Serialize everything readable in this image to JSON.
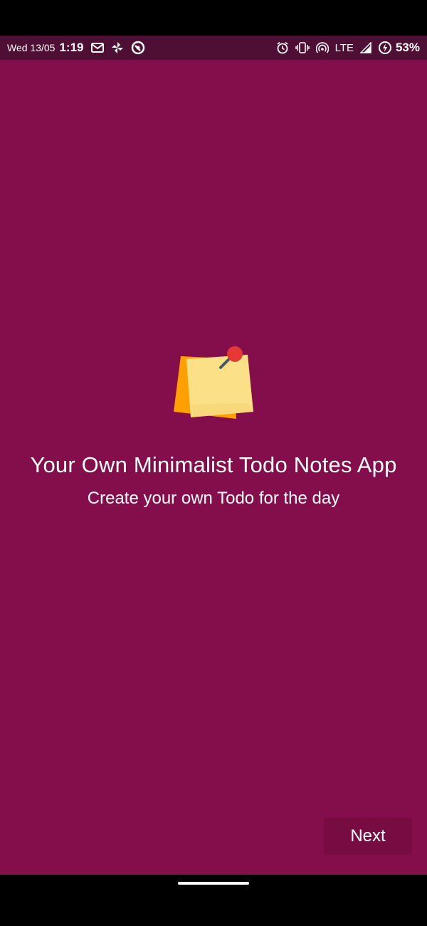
{
  "status_bar": {
    "date": "Wed 13/05",
    "time": "1:19",
    "network": "LTE",
    "battery": "53%",
    "icons_left": [
      "gmail-icon",
      "pinwheel-icon",
      "vpn-icon"
    ],
    "icons_right": [
      "alarm-icon",
      "vibrate-icon",
      "hotspot-icon",
      "signal-icon",
      "battery-saver-icon"
    ]
  },
  "onboarding": {
    "illustration": "sticky-note-icon",
    "title": "Your Own Minimalist Todo Notes App",
    "subtitle": "Create your own Todo for the day",
    "next_label": "Next"
  },
  "colors": {
    "background": "#840e4b",
    "status_bar": "#4f0f35",
    "button": "#770c42",
    "note_back": "#ffa000",
    "note_front": "#fbe088",
    "pin": "#e53935"
  }
}
